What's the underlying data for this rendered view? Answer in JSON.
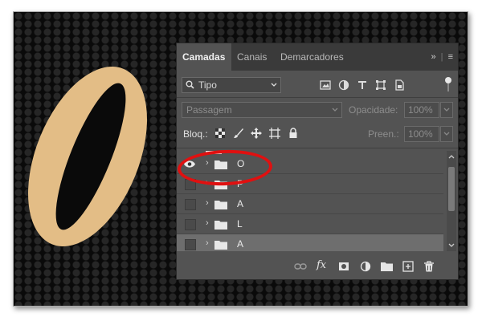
{
  "tabs": [
    {
      "label": "Camadas",
      "active": true
    },
    {
      "label": "Canais",
      "active": false
    },
    {
      "label": "Demarcadores",
      "active": false
    }
  ],
  "tab_controls": {
    "collapse": "»",
    "menu": "≡"
  },
  "filter": {
    "kind": "Tipo"
  },
  "blend_mode": "Passagem",
  "opacity": {
    "label": "Opacidade:",
    "value": "100%"
  },
  "lock": {
    "label": "Bloq.:"
  },
  "fill": {
    "label": "Preen.:",
    "value": "100%"
  },
  "layers": [
    {
      "name": "O",
      "visible": true,
      "selected": false
    },
    {
      "name": "P",
      "visible": false,
      "selected": false
    },
    {
      "name": "A",
      "visible": false,
      "selected": false
    },
    {
      "name": "L",
      "visible": false,
      "selected": false
    },
    {
      "name": "A",
      "visible": false,
      "selected": true
    }
  ],
  "canvas": {
    "big_letter": "O",
    "letter_color": "#e3bd86"
  },
  "highlight_color": "#e01010",
  "icons": [
    "search-icon",
    "image-filter-icon",
    "adjustment-filter-icon",
    "type-filter-icon",
    "shape-filter-icon",
    "smart-object-filter-icon",
    "lock-transparency-icon",
    "lock-pixels-icon",
    "lock-position-icon",
    "lock-artboard-icon",
    "lock-all-icon",
    "eye-icon",
    "folder-icon",
    "link-icon",
    "fx-icon",
    "mask-icon",
    "adjustment-layer-icon",
    "new-group-icon",
    "new-layer-icon",
    "trash-icon"
  ]
}
